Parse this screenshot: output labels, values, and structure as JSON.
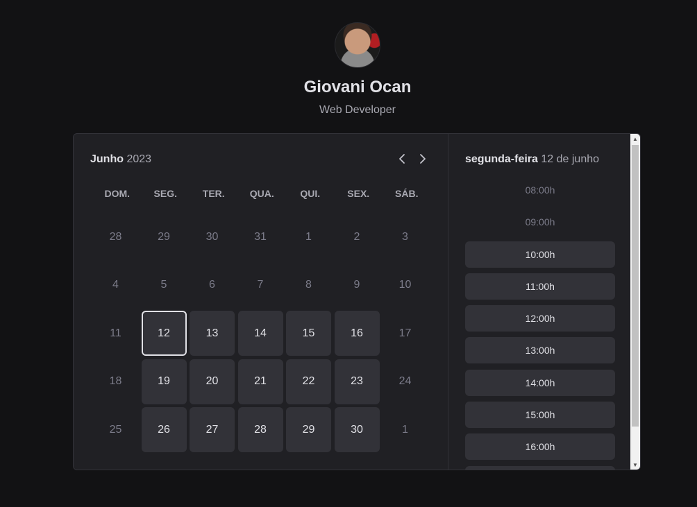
{
  "profile": {
    "name": "Giovani Ocan",
    "role": "Web Developer"
  },
  "calendar": {
    "month": "Junho",
    "year": "2023",
    "weekdays": [
      "DOM.",
      "SEG.",
      "TER.",
      "QUA.",
      "QUI.",
      "SEX.",
      "SÁB."
    ],
    "weeks": [
      [
        {
          "d": "28",
          "s": "disabled"
        },
        {
          "d": "29",
          "s": "disabled"
        },
        {
          "d": "30",
          "s": "disabled"
        },
        {
          "d": "31",
          "s": "disabled"
        },
        {
          "d": "1",
          "s": "disabled"
        },
        {
          "d": "2",
          "s": "disabled"
        },
        {
          "d": "3",
          "s": "disabled"
        }
      ],
      [
        {
          "d": "4",
          "s": "disabled"
        },
        {
          "d": "5",
          "s": "disabled"
        },
        {
          "d": "6",
          "s": "disabled"
        },
        {
          "d": "7",
          "s": "disabled"
        },
        {
          "d": "8",
          "s": "disabled"
        },
        {
          "d": "9",
          "s": "disabled"
        },
        {
          "d": "10",
          "s": "disabled"
        }
      ],
      [
        {
          "d": "11",
          "s": "disabled"
        },
        {
          "d": "12",
          "s": "selected"
        },
        {
          "d": "13",
          "s": "available"
        },
        {
          "d": "14",
          "s": "available"
        },
        {
          "d": "15",
          "s": "available"
        },
        {
          "d": "16",
          "s": "available"
        },
        {
          "d": "17",
          "s": "disabled"
        }
      ],
      [
        {
          "d": "18",
          "s": "disabled"
        },
        {
          "d": "19",
          "s": "available"
        },
        {
          "d": "20",
          "s": "available"
        },
        {
          "d": "21",
          "s": "available"
        },
        {
          "d": "22",
          "s": "available"
        },
        {
          "d": "23",
          "s": "available"
        },
        {
          "d": "24",
          "s": "disabled"
        }
      ],
      [
        {
          "d": "25",
          "s": "disabled"
        },
        {
          "d": "26",
          "s": "available"
        },
        {
          "d": "27",
          "s": "available"
        },
        {
          "d": "28",
          "s": "available"
        },
        {
          "d": "29",
          "s": "available"
        },
        {
          "d": "30",
          "s": "available"
        },
        {
          "d": "1",
          "s": "disabled"
        }
      ]
    ]
  },
  "times": {
    "weekday": "segunda-feira",
    "date": "12 de junho",
    "slots": [
      {
        "t": "08:00h",
        "s": "disabled"
      },
      {
        "t": "09:00h",
        "s": "disabled"
      },
      {
        "t": "10:00h",
        "s": "available"
      },
      {
        "t": "11:00h",
        "s": "available"
      },
      {
        "t": "12:00h",
        "s": "available"
      },
      {
        "t": "13:00h",
        "s": "available"
      },
      {
        "t": "14:00h",
        "s": "available"
      },
      {
        "t": "15:00h",
        "s": "available"
      },
      {
        "t": "16:00h",
        "s": "available"
      },
      {
        "t": "",
        "s": "available"
      }
    ]
  },
  "icons": {
    "prev": "chevron-left-icon",
    "next": "chevron-right-icon"
  },
  "colors": {
    "background": "#121214",
    "panel": "#202024",
    "available": "#323238",
    "border": "#323238"
  }
}
